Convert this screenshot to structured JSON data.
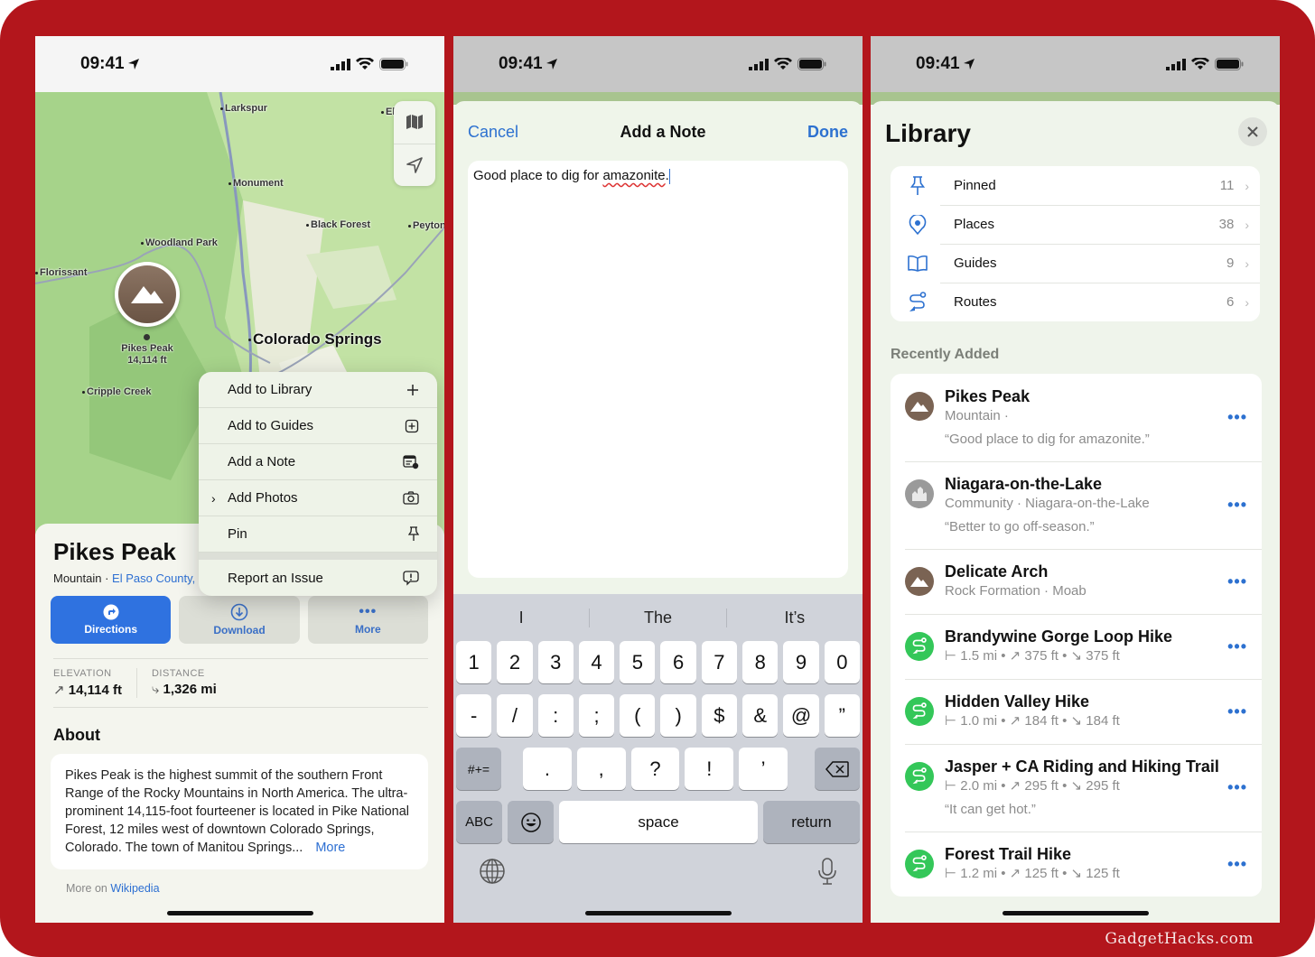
{
  "status": {
    "time": "09:41"
  },
  "map": {
    "labels": [
      "Larkspur",
      "Monument",
      "Black Forest",
      "Peyton",
      "Woodland Park",
      "Florissant",
      "Cripple Creek",
      "El"
    ],
    "city": "Colorado Springs",
    "pin": {
      "name": "Pikes Peak",
      "elevation": "14,114 ft"
    }
  },
  "context_menu": {
    "items": [
      {
        "label": "Add to Library",
        "icon": "plus-icon"
      },
      {
        "label": "Add to Guides",
        "icon": "plus-square-icon"
      },
      {
        "label": "Add a Note",
        "icon": "note-icon"
      },
      {
        "label": "Add Photos",
        "icon": "camera-icon"
      },
      {
        "label": "Pin",
        "icon": "pin-icon"
      }
    ],
    "report": {
      "label": "Report an Issue",
      "icon": "exclamation-bubble-icon"
    }
  },
  "place": {
    "title": "Pikes Peak",
    "category": "Mountain · ",
    "county": "El Paso County,",
    "actions": [
      {
        "label": "Directions"
      },
      {
        "label": "Download"
      },
      {
        "label": "More"
      }
    ],
    "stats": [
      {
        "key": "ELEVATION",
        "value": "14,114 ft"
      },
      {
        "key": "DISTANCE",
        "value": "1,326 mi"
      }
    ],
    "about_heading": "About",
    "about_text": "Pikes Peak is the highest summit of the southern Front Range of the Rocky Mountains in North America. The ultra-prominent 14,115-foot fourteener is located in Pike National Forest, 12 miles west of downtown Colorado Springs, Colorado. The town of Manitou Springs...",
    "about_more": "More",
    "source_prefix": "More on ",
    "source_link": "Wikipedia"
  },
  "note": {
    "cancel": "Cancel",
    "title": "Add a Note",
    "done": "Done",
    "text_before": "Good place to dig for ",
    "text_misspelled": "amazonite",
    "text_after": "."
  },
  "keyboard": {
    "suggestions": [
      "I",
      "The",
      "It’s"
    ],
    "row1": [
      "1",
      "2",
      "3",
      "4",
      "5",
      "6",
      "7",
      "8",
      "9",
      "0"
    ],
    "row2": [
      "-",
      "/",
      ":",
      ";",
      "(",
      ")",
      "$",
      "&",
      "@",
      "”"
    ],
    "row3": [
      ".",
      ",",
      "?",
      "!",
      "’"
    ],
    "symbols": "#+=",
    "abc": "ABC",
    "space": "space",
    "return": "return"
  },
  "library": {
    "title": "Library",
    "categories": [
      {
        "label": "Pinned",
        "count": "11"
      },
      {
        "label": "Places",
        "count": "38"
      },
      {
        "label": "Guides",
        "count": "9"
      },
      {
        "label": "Routes",
        "count": "6"
      }
    ],
    "recent_heading": "Recently Added",
    "recent": [
      {
        "title": "Pikes Peak",
        "subtitle": "Mountain ·",
        "note": "“Good place to dig for amazonite.”",
        "type": "mountain"
      },
      {
        "title": "Niagara-on-the-Lake",
        "subtitle": "Community · Niagara-on-the-Lake",
        "note": "“Better to go off-season.”",
        "type": "community"
      },
      {
        "title": "Delicate Arch",
        "subtitle": "Rock Formation · Moab",
        "type": "mountain"
      },
      {
        "title": "Brandywine Gorge Loop Hike",
        "subtitle": "⊢ 1.5 mi • ↗ 375 ft • ↘ 375 ft",
        "type": "route"
      },
      {
        "title": "Hidden Valley Hike",
        "subtitle": "⊢ 1.0 mi • ↗ 184 ft • ↘ 184 ft",
        "type": "route"
      },
      {
        "title": "Jasper + CA Riding and Hiking Trail",
        "subtitle": "⊢ 2.0 mi • ↗ 295 ft • ↘ 295 ft",
        "note": "“It can get hot.”",
        "type": "route"
      },
      {
        "title": "Forest Trail Hike",
        "subtitle": "⊢ 1.2 mi • ↗ 125 ft • ↘ 125 ft",
        "type": "route"
      }
    ]
  },
  "watermark": "GadgetHacks.com",
  "colors": {
    "frame": "#b3161c",
    "accent": "#2d71d0",
    "route_green": "#34c759",
    "mountain_brown": "#7a6353"
  }
}
